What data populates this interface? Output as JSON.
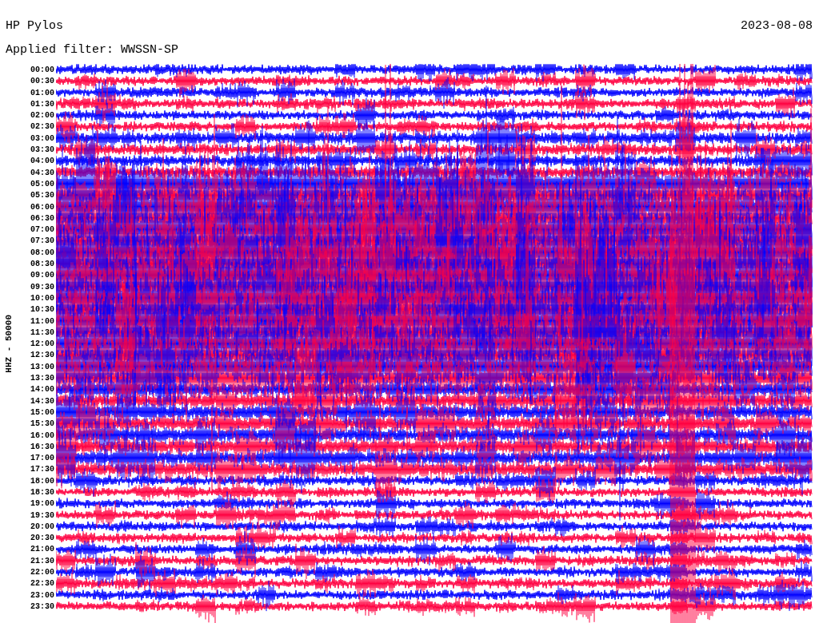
{
  "header": {
    "station": "HP Pylos",
    "date": "2023-08-08",
    "filter": "Applied filter: WWSSN-SP"
  },
  "channel_label": "HHZ - 50000",
  "rows": [
    {
      "time": "00:00",
      "color": "#0000ff"
    },
    {
      "time": "00:30",
      "color": "#ff0040"
    },
    {
      "time": "01:00",
      "color": "#0000ff"
    },
    {
      "time": "01:30",
      "color": "#ff0040"
    },
    {
      "time": "02:00",
      "color": "#0000ff"
    },
    {
      "time": "02:30",
      "color": "#ff0040"
    },
    {
      "time": "03:00",
      "color": "#0000ff"
    },
    {
      "time": "03:30",
      "color": "#ff0040"
    },
    {
      "time": "04:00",
      "color": "#0000ff"
    },
    {
      "time": "04:30",
      "color": "#ff0040"
    },
    {
      "time": "05:00",
      "color": "#0000ff"
    },
    {
      "time": "05:30",
      "color": "#ff0040"
    },
    {
      "time": "06:00",
      "color": "#0000ff"
    },
    {
      "time": "06:30",
      "color": "#ff0040"
    },
    {
      "time": "07:00",
      "color": "#0000ff"
    },
    {
      "time": "07:30",
      "color": "#ff0040"
    },
    {
      "time": "08:00",
      "color": "#0000ff"
    },
    {
      "time": "08:30",
      "color": "#ff0040"
    },
    {
      "time": "09:00",
      "color": "#0000ff"
    },
    {
      "time": "09:30",
      "color": "#ff0040"
    },
    {
      "time": "10:00",
      "color": "#0000ff"
    },
    {
      "time": "10:30",
      "color": "#ff0040"
    },
    {
      "time": "11:00",
      "color": "#0000ff"
    },
    {
      "time": "11:30",
      "color": "#ff0040"
    },
    {
      "time": "12:00",
      "color": "#0000ff"
    },
    {
      "time": "12:30",
      "color": "#ff0040"
    },
    {
      "time": "13:00",
      "color": "#0000ff"
    },
    {
      "time": "13:30",
      "color": "#ff0040"
    },
    {
      "time": "14:00",
      "color": "#0000ff"
    },
    {
      "time": "14:30",
      "color": "#ff0040"
    },
    {
      "time": "15:00",
      "color": "#0000ff"
    },
    {
      "time": "15:30",
      "color": "#ff0040"
    },
    {
      "time": "16:00",
      "color": "#0000ff"
    },
    {
      "time": "16:30",
      "color": "#ff0040"
    },
    {
      "time": "17:00",
      "color": "#0000ff"
    },
    {
      "time": "17:30",
      "color": "#ff0040"
    },
    {
      "time": "18:00",
      "color": "#0000ff"
    },
    {
      "time": "18:30",
      "color": "#ff0040"
    },
    {
      "time": "19:00",
      "color": "#0000ff"
    },
    {
      "time": "19:30",
      "color": "#ff0040"
    },
    {
      "time": "20:00",
      "color": "#0000ff"
    },
    {
      "time": "20:30",
      "color": "#ff0040"
    },
    {
      "time": "21:00",
      "color": "#0000ff"
    },
    {
      "time": "21:30",
      "color": "#ff0040"
    },
    {
      "time": "22:00",
      "color": "#0000ff"
    },
    {
      "time": "22:30",
      "color": "#ff0040"
    },
    {
      "time": "23:00",
      "color": "#0000ff"
    },
    {
      "time": "23:30",
      "color": "#ff0040"
    }
  ]
}
